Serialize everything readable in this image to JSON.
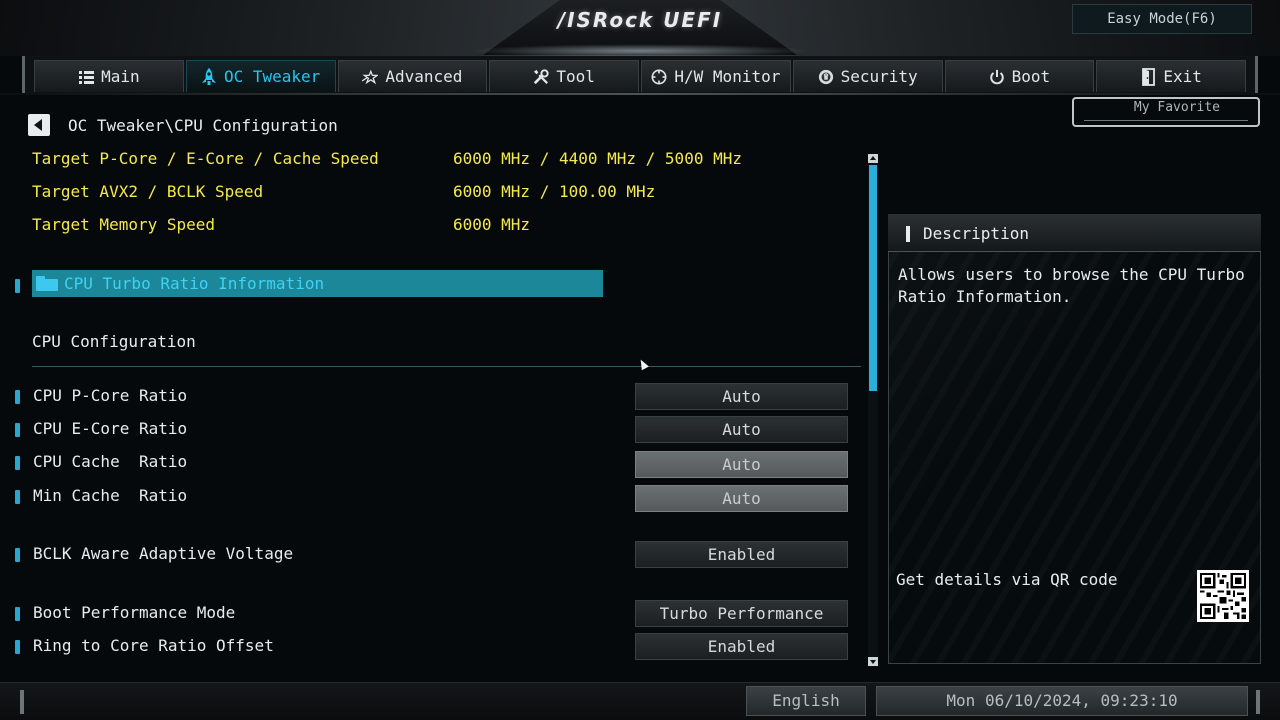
{
  "header": {
    "brand": "/ISRock UEFI",
    "easy_mode": "Easy Mode(F6)"
  },
  "nav": {
    "tabs": [
      {
        "label": "Main",
        "icon": "list-icon"
      },
      {
        "label": "OC Tweaker",
        "icon": "rocket-icon",
        "active": true
      },
      {
        "label": "Advanced",
        "icon": "star-icon"
      },
      {
        "label": "Tool",
        "icon": "wrench-icon"
      },
      {
        "label": "H/W Monitor",
        "icon": "monitor-icon"
      },
      {
        "label": "Security",
        "icon": "shield-icon"
      },
      {
        "label": "Boot",
        "icon": "power-icon"
      },
      {
        "label": "Exit",
        "icon": "exit-icon"
      }
    ]
  },
  "breadcrumb": "OC Tweaker\\CPU Configuration",
  "favorite_label": "My Favorite",
  "targets": [
    {
      "label": "Target P-Core / E-Core / Cache Speed",
      "value": "6000 MHz / 4400 MHz / 5000 MHz"
    },
    {
      "label": "Target AVX2 / BCLK Speed",
      "value": "6000 MHz / 100.00 MHz"
    },
    {
      "label": "Target Memory Speed",
      "value": "6000 MHz"
    }
  ],
  "selected_item": "CPU Turbo Ratio Information",
  "section_title": "CPU Configuration",
  "settings": [
    {
      "label": "CPU P-Core Ratio",
      "value": "Auto",
      "dim": false
    },
    {
      "label": "CPU E-Core Ratio",
      "value": "Auto",
      "dim": false
    },
    {
      "label": "CPU Cache  Ratio",
      "value": "Auto",
      "dim": true
    },
    {
      "label": "Min Cache  Ratio",
      "value": "Auto",
      "dim": true
    },
    {
      "label": "BCLK Aware Adaptive Voltage",
      "value": "Enabled",
      "dim": false
    },
    {
      "label": "Boot Performance Mode",
      "value": "Turbo Performance",
      "dim": false
    },
    {
      "label": "Ring to Core Ratio Offset",
      "value": "Enabled",
      "dim": false
    }
  ],
  "description": {
    "title": "Description",
    "text": "Allows users to browse the CPU Turbo Ratio Information.",
    "qr_label": "Get details via QR code"
  },
  "footer": {
    "language": "English",
    "datetime": "Mon 06/10/2024, 09:23:10"
  },
  "colors": {
    "accent": "#23c6ec",
    "highlight_row": "#1b8799",
    "target_text": "#f4e94d"
  }
}
